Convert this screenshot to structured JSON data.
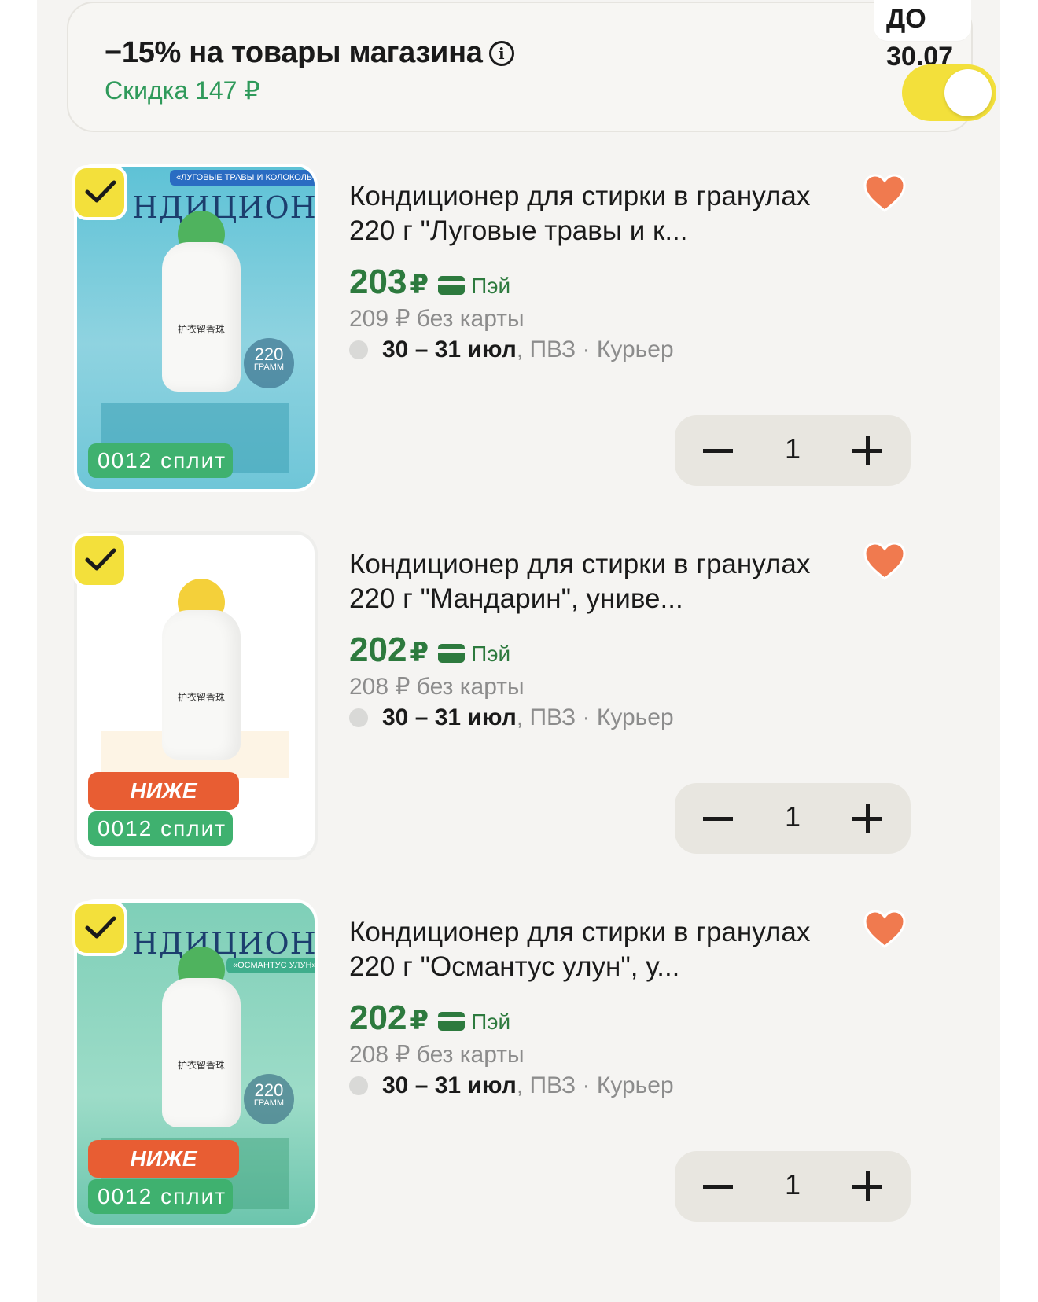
{
  "promo": {
    "title": "−15% на товары магазина",
    "info_icon": "info-icon",
    "discount": "Скидка 147 ₽",
    "deadline": "ДО 30.07",
    "toggle_on": true
  },
  "colors": {
    "accent_yellow": "#f3e03b",
    "price_green": "#2d7a3e",
    "discount_green": "#2f9a5a",
    "heart_orange": "#f07a4f",
    "badge_red": "#e85d33",
    "split_green": "#3fb16f"
  },
  "items": [
    {
      "selected": true,
      "title": "Кондиционер для стирки в гранулах 220 г \"Луговые травы и к...",
      "price": "203",
      "currency": "₽",
      "pay_label": "Пэй",
      "old_price": "209 ₽ без карты",
      "delivery_date": "30 – 31 июл",
      "delivery_methods": ", ПВЗ · Курьер",
      "quantity": "1",
      "favorite": true,
      "badge_split": "0012 сплит",
      "image_text": {
        "brand": "НДИЦИОНЕР",
        "tag": "«ЛУГОВЫЕ ТРАВЫ И КОЛОКОЛЬЧИК»",
        "label": "护衣留香珠",
        "grams": "220",
        "grams_unit": "ГРАММ"
      }
    },
    {
      "selected": true,
      "title": "Кондиционер для стирки в гранулах 220 г \"Мандарин\", униве...",
      "price": "202",
      "currency": "₽",
      "pay_label": "Пэй",
      "old_price": "208 ₽ без карты",
      "delivery_date": "30 – 31 июл",
      "delivery_methods": ", ПВЗ · Курьер",
      "quantity": "1",
      "favorite": true,
      "badge_market": "НИЖЕ РЫНКА",
      "badge_split": "0012 сплит",
      "image_text": {
        "label": "护衣留香珠"
      }
    },
    {
      "selected": true,
      "title": "Кондиционер для стирки в гранулах 220 г \"Османтус улун\", у...",
      "price": "202",
      "currency": "₽",
      "pay_label": "Пэй",
      "old_price": "208 ₽ без карты",
      "delivery_date": "30 – 31 июл",
      "delivery_methods": ", ПВЗ · Курьер",
      "quantity": "1",
      "favorite": true,
      "badge_market": "НИЖЕ РЫНКА",
      "badge_split": "0012 сплит",
      "image_text": {
        "brand": "НДИЦИОНЕР",
        "tag": "«ОСМАНТУС УЛУН»",
        "label": "护衣留香珠",
        "grams": "220",
        "grams_unit": "ГРАММ"
      }
    }
  ]
}
